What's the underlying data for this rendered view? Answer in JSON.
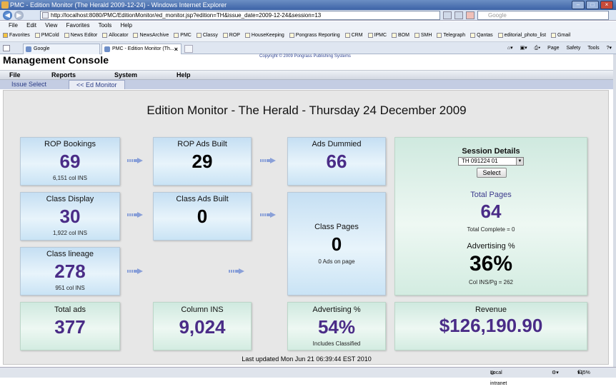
{
  "browser": {
    "window_title": "PMC - Edition Monitor (The Herald 2009-12-24) - Windows Internet Explorer",
    "url": "http://localhost:8080/PMC/EditionMonitor/ed_monitor.jsp?edition=TH&issue_date=2009-12-24&session=13",
    "search_placeholder": "Google",
    "menu": [
      "File",
      "Edit",
      "View",
      "Favorites",
      "Tools",
      "Help"
    ],
    "favorites_label": "Favorites",
    "favorites": [
      "PMCold",
      "News Editor",
      "Allocator",
      "NewsArchive",
      "PMC",
      "Classy",
      "ROP",
      "HouseKeeping",
      "Pongrass Reporting",
      "CRM",
      "IPMC",
      "BOM",
      "SMH",
      "Telegraph",
      "Qantas",
      "editorial_photo_list",
      "Gmail"
    ],
    "tabs": [
      "Google",
      "PMC - Edition Monitor (Th..."
    ],
    "tools": [
      "Page",
      "Safety",
      "Tools"
    ],
    "status_zone": "Local intranet",
    "zoom": "135%"
  },
  "app": {
    "title": "Management Console",
    "copyright": "Copyright © 2009 Pongrass Publishing Systems",
    "menu": [
      "File",
      "Reports",
      "System",
      "Help"
    ],
    "subnav": [
      "Issue Select",
      "<< Ed Monitor"
    ]
  },
  "monitor": {
    "title": "Edition Monitor - The Herald - Thursday 24 December 2009",
    "rop_bookings": {
      "label": "ROP Bookings",
      "value": "69",
      "sub": "6,151 col INS"
    },
    "rop_ads_built": {
      "label": "ROP Ads Built",
      "value": "29"
    },
    "ads_dummied": {
      "label": "Ads Dummied",
      "value": "66"
    },
    "class_display": {
      "label": "Class Display",
      "value": "30",
      "sub": "1,922 col INS"
    },
    "class_ads_built": {
      "label": "Class Ads Built",
      "value": "0"
    },
    "class_pages": {
      "label": "Class Pages",
      "value": "0",
      "sub": "0 Ads on page"
    },
    "class_lineage": {
      "label": "Class lineage",
      "value": "278",
      "sub": "951 col INS"
    },
    "total_ads": {
      "label": "Total ads",
      "value": "377"
    },
    "column_ins": {
      "label": "Column INS",
      "value": "9,024"
    },
    "advertising_pct": {
      "label": "Advertising %",
      "value": "54%",
      "sub": "Includes Classified"
    },
    "revenue": {
      "label": "Revenue",
      "value": "$126,190.90"
    },
    "session": {
      "label": "Session Details",
      "selected": "TH  091224  01",
      "select_button": "Select",
      "total_pages_label": "Total Pages",
      "total_pages_value": "64",
      "total_complete": "Total Complete = 0",
      "adv_label": "Advertising %",
      "adv_value": "36%",
      "col_ins_pg": "Col INS/Pg = 262"
    },
    "last_updated": "Last updated Mon Jun 21 06:39:44 EST 2010"
  }
}
